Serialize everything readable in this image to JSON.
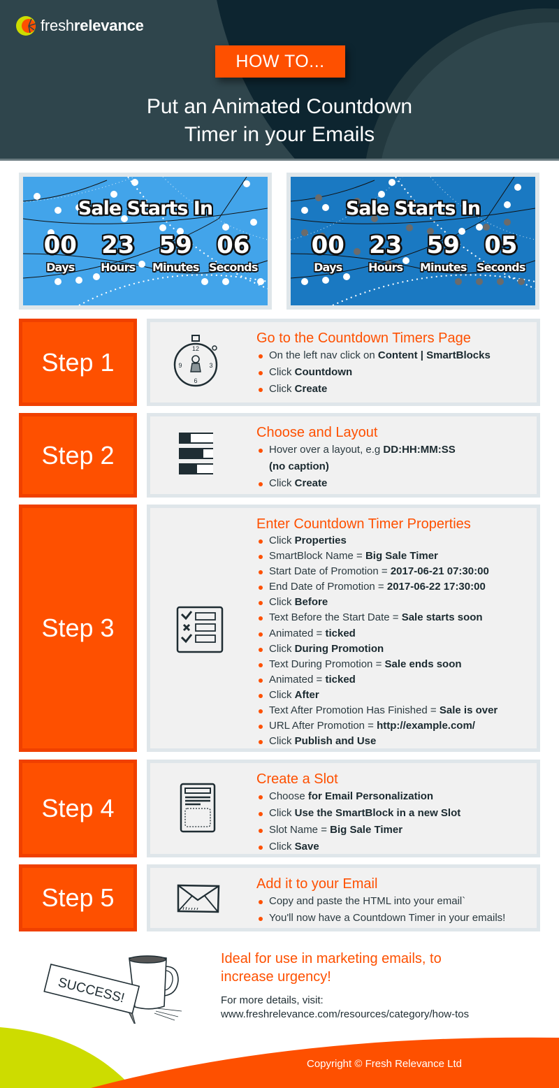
{
  "brand": {
    "logo_text_light": "fresh",
    "logo_text_bold": "relevance",
    "accent_color": "#fe5000",
    "lime_color": "#cddc00",
    "dark_color": "#0d2530"
  },
  "header": {
    "badge": "HOW TO...",
    "title_line1": "Put an Animated Countdown",
    "title_line2": "Timer in your Emails"
  },
  "timers": [
    {
      "heading": "Sale Starts In",
      "background_color": "#42a4ea",
      "units": [
        {
          "value": "00",
          "label": "Days"
        },
        {
          "value": "23",
          "label": "Hours"
        },
        {
          "value": "59",
          "label": "Minutes"
        },
        {
          "value": "06",
          "label": "Seconds"
        }
      ]
    },
    {
      "heading": "Sale Starts In",
      "background_color": "#1a79c2",
      "units": [
        {
          "value": "00",
          "label": "Days"
        },
        {
          "value": "23",
          "label": "Hours"
        },
        {
          "value": "59",
          "label": "Minutes"
        },
        {
          "value": "05",
          "label": "Seconds"
        }
      ]
    }
  ],
  "steps": [
    {
      "label": "Step 1",
      "icon": "stopwatch-icon",
      "title": "Go to the Countdown Timers Page",
      "items": [
        {
          "text": "On the left nav click on ",
          "bold": "Content | SmartBlocks"
        },
        {
          "text": "Click ",
          "bold": "Countdown"
        },
        {
          "text": "Click ",
          "bold": "Create"
        }
      ]
    },
    {
      "label": "Step 2",
      "icon": "layout-bars-icon",
      "title": "Choose and Layout",
      "items": [
        {
          "text": "Hover over a layout, e.g ",
          "bold": "DD:HH:MM:SS"
        },
        {
          "text": "",
          "bold": "(no caption)",
          "continuation": true
        },
        {
          "text": "Click ",
          "bold": "Create"
        }
      ]
    },
    {
      "label": "Step 3",
      "icon": "checklist-icon",
      "title": "Enter Countdown Timer Properties",
      "items": [
        {
          "text": "Click ",
          "bold": "Properties"
        },
        {
          "text": "SmartBlock Name = ",
          "bold": "Big Sale Timer"
        },
        {
          "text": "Start Date of Promotion = ",
          "bold": "2017-06-21 07:30:00"
        },
        {
          "text": "End Date of Promotion = ",
          "bold": "2017-06-22 17:30:00"
        },
        {
          "text": "Click ",
          "bold": "Before"
        },
        {
          "text": "Text Before the Start Date = ",
          "bold": "Sale starts soon"
        },
        {
          "text": "Animated = ",
          "bold": "ticked"
        },
        {
          "text": "Click ",
          "bold": "During Promotion"
        },
        {
          "text": "Text During Promotion = ",
          "bold": "Sale ends soon"
        },
        {
          "text": "Animated = ",
          "bold": "ticked"
        },
        {
          "text": "Click ",
          "bold": "After"
        },
        {
          "text": "Text After Promotion Has Finished = ",
          "bold": "Sale is over"
        },
        {
          "text": "URL After Promotion = ",
          "bold": "http://example.com/"
        },
        {
          "text": "Click ",
          "bold": "Publish and Use"
        }
      ]
    },
    {
      "label": "Step 4",
      "icon": "document-slot-icon",
      "title": "Create a Slot",
      "items": [
        {
          "text": "Choose ",
          "bold": "for Email Personalization"
        },
        {
          "text": "Click ",
          "bold": "Use the SmartBlock in a new Slot"
        },
        {
          "text": "Slot Name = ",
          "bold": "Big Sale Timer"
        },
        {
          "text": "Click ",
          "bold": "Save"
        }
      ]
    },
    {
      "label": "Step 5",
      "icon": "envelope-icon",
      "title": "Add it to your Email",
      "items": [
        {
          "text": "Copy and paste the HTML into your email`",
          "bold": ""
        },
        {
          "text": "You'll now have a Countdown Timer in your emails!",
          "bold": ""
        }
      ]
    }
  ],
  "footer": {
    "success_sign": "SUCCESS!",
    "cta_line1": "Ideal for use in marketing emails, to",
    "cta_line2": "increase urgency!",
    "more_label": "For more details, visit:",
    "more_url": "www.freshrelevance.com/resources/category/how-tos",
    "copyright": "Copyright © Fresh Relevance Ltd"
  }
}
